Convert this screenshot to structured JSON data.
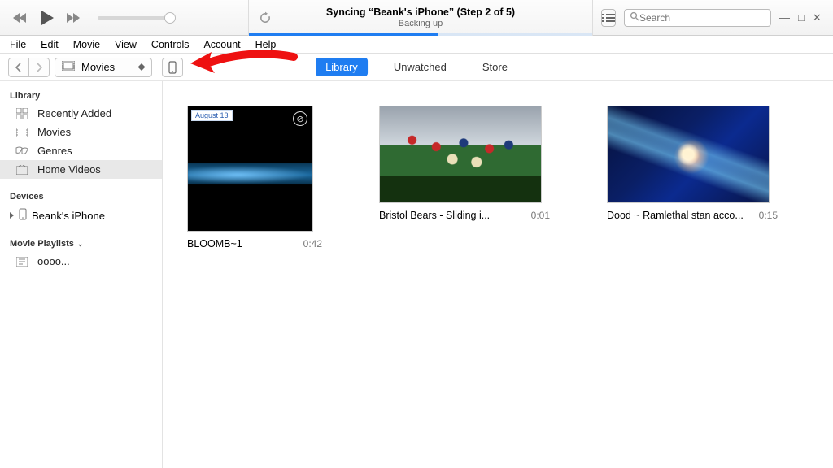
{
  "player": {
    "lcd_title": "Syncing “Beank's iPhone” (Step 2 of 5)",
    "lcd_subtitle": "Backing up",
    "search_placeholder": "Search"
  },
  "menu": [
    "File",
    "Edit",
    "Movie",
    "View",
    "Controls",
    "Account",
    "Help"
  ],
  "toolbar": {
    "media_label": "Movies",
    "tabs": {
      "library": "Library",
      "unwatched": "Unwatched",
      "store": "Store"
    }
  },
  "sidebar": {
    "library_header": "Library",
    "library_items": [
      {
        "icon": "grid",
        "label": "Recently Added"
      },
      {
        "icon": "film",
        "label": "Movies"
      },
      {
        "icon": "masks",
        "label": "Genres"
      },
      {
        "icon": "home",
        "label": "Home Videos",
        "selected": true
      }
    ],
    "devices_header": "Devices",
    "device_label": "Beank's iPhone",
    "playlists_header": "Movie Playlists",
    "playlist_label": "oooo..."
  },
  "videos": [
    {
      "title": "BLOOMB~1",
      "duration": "0:42",
      "badge": "August 13",
      "wide": false
    },
    {
      "title": "Bristol Bears - Sliding i...",
      "duration": "0:01",
      "wide": true
    },
    {
      "title": "Dood ~ Ramlethal stan acco...",
      "duration": "0:15",
      "wide": true
    }
  ]
}
